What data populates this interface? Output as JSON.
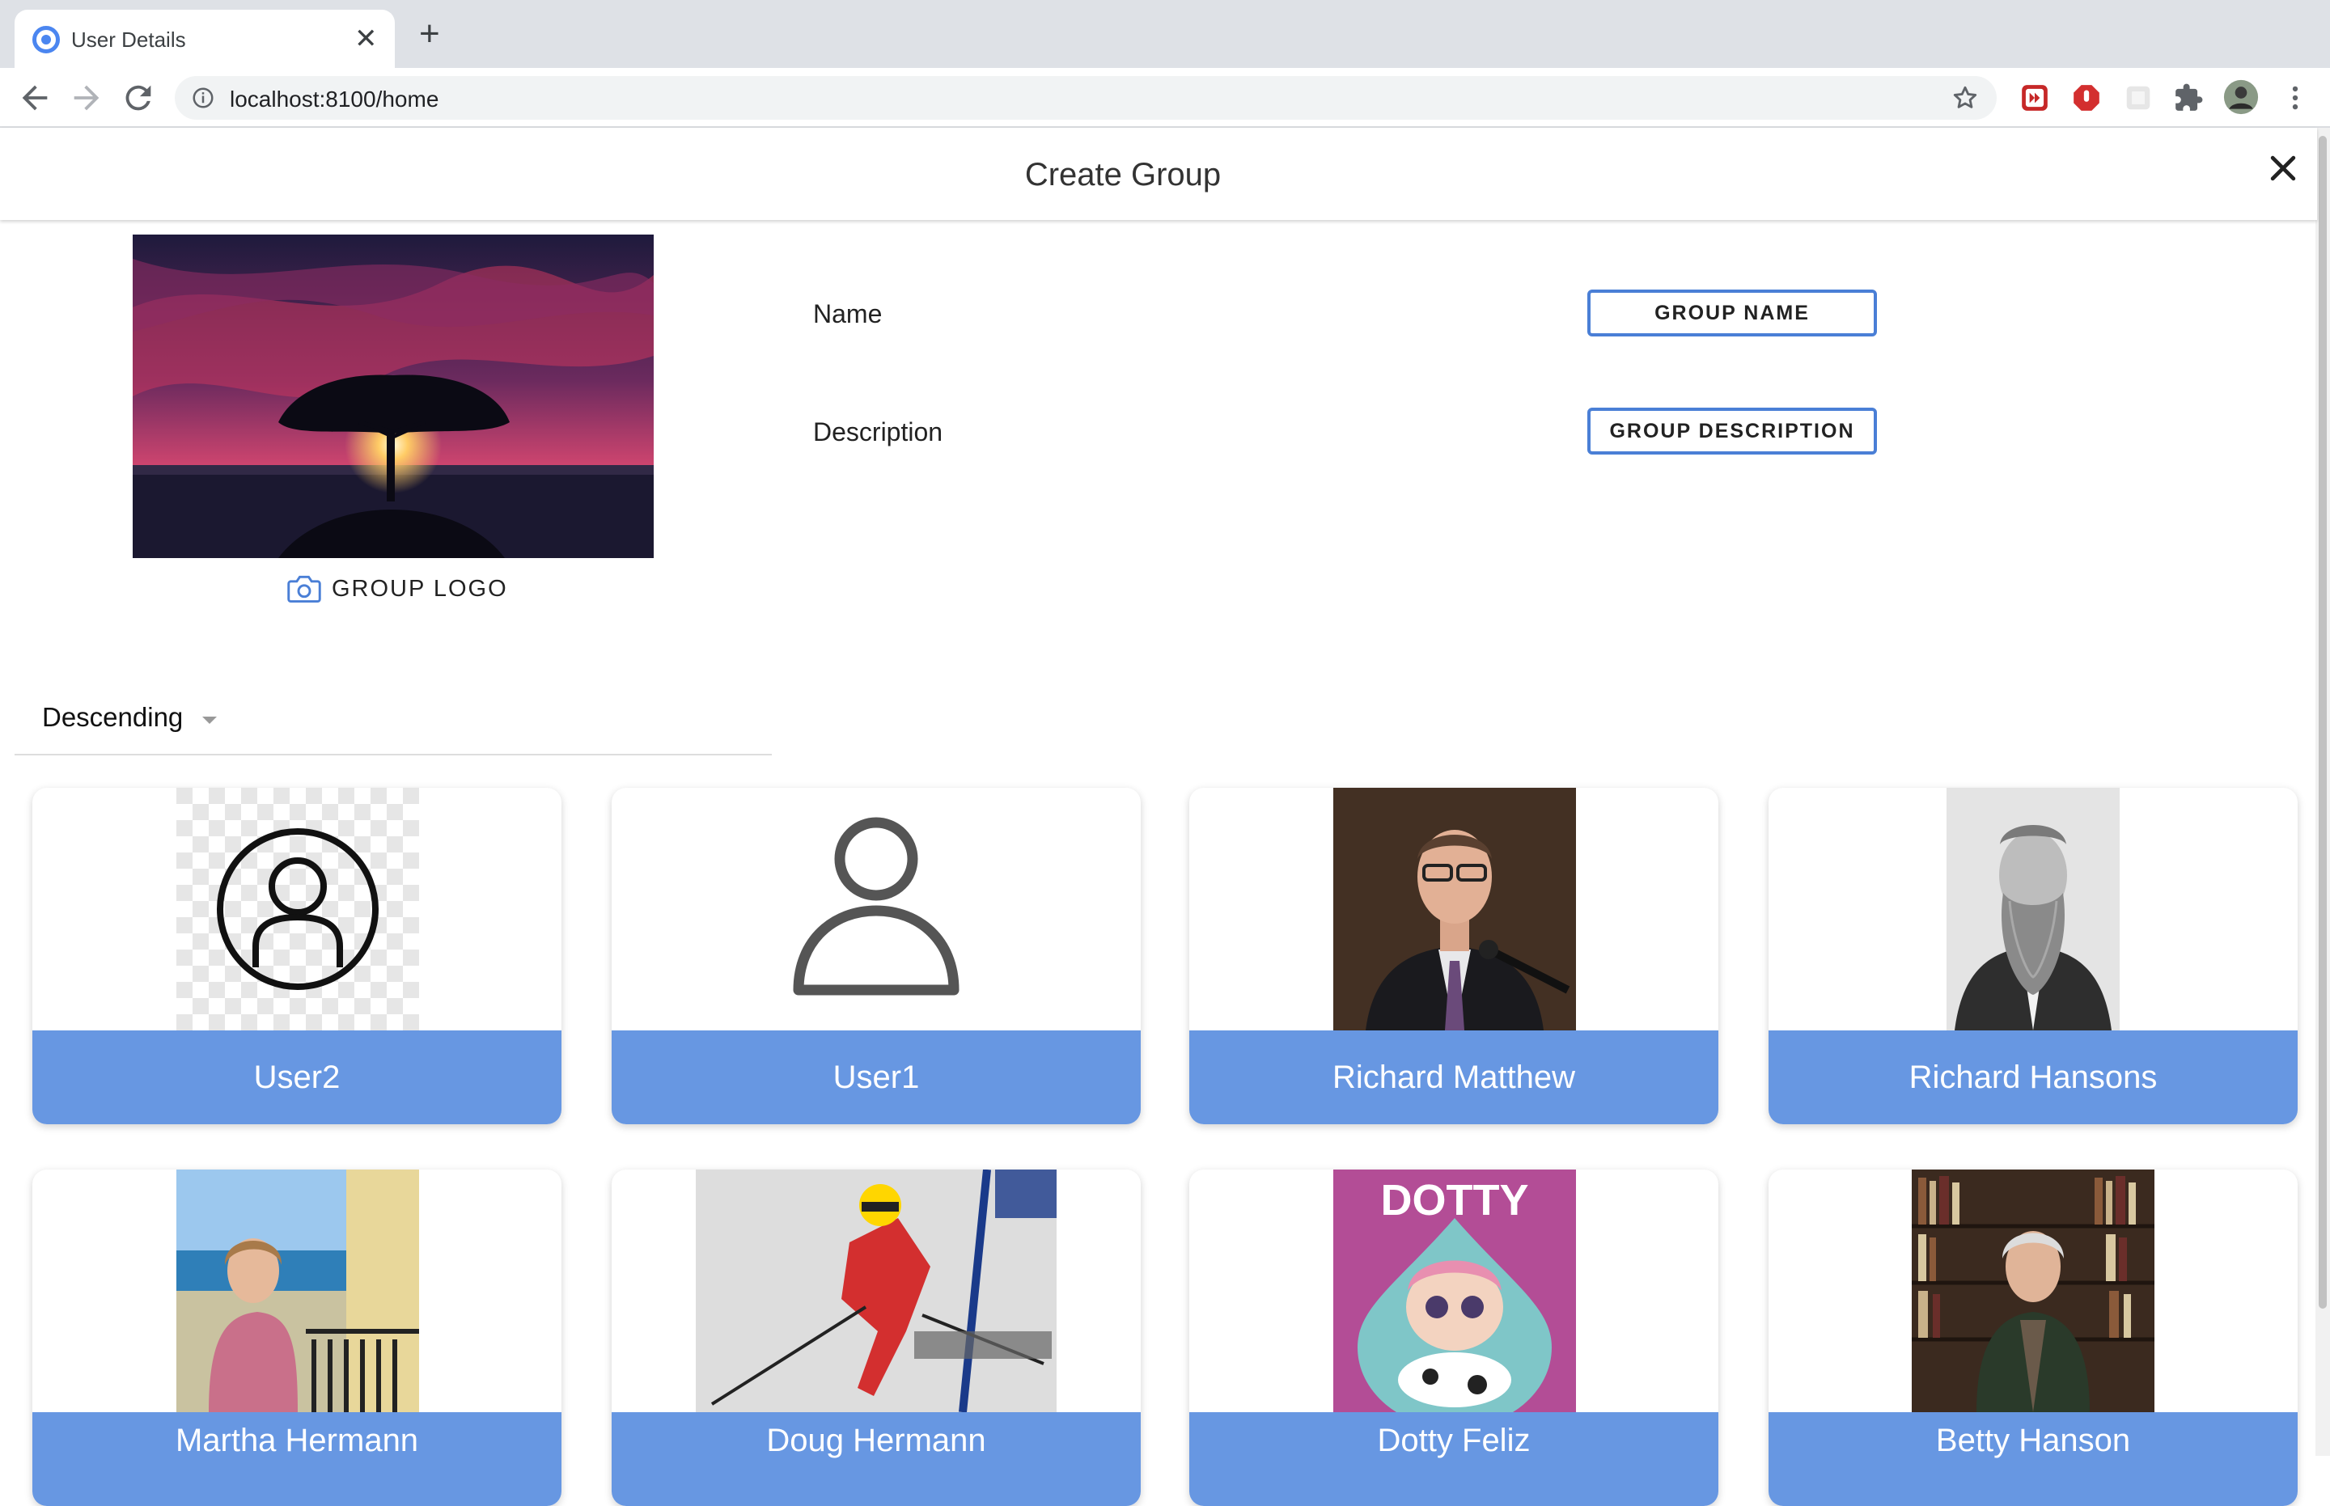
{
  "browser": {
    "tab_title": "User Details",
    "tab_close": "✕",
    "new_tab": "+",
    "url": "localhost:8100/home"
  },
  "page": {
    "title": "Create Group",
    "logo_button_label": "GROUP LOGO",
    "form": {
      "name_label": "Name",
      "name_button": "GROUP NAME",
      "description_label": "Description",
      "description_button": "GROUP DESCRIPTION"
    },
    "sort": {
      "selected": "Descending"
    }
  },
  "users": [
    {
      "name": "User2",
      "photo": "default-avatar-transparent"
    },
    {
      "name": "User1",
      "photo": "default-person-silhouette"
    },
    {
      "name": "Richard Matthew",
      "photo": "man-with-microphone"
    },
    {
      "name": "Richard Hansons",
      "photo": "bearded-man-engraving"
    },
    {
      "name": "Martha Hermann",
      "photo": "woman-on-balcony"
    },
    {
      "name": "Doug Hermann",
      "photo": "skier"
    },
    {
      "name": "Dotty Feliz",
      "photo": "dotty-doll"
    },
    {
      "name": "Betty Hanson",
      "photo": "woman-at-bookshelf"
    }
  ],
  "dotty_banner": "DOTTY",
  "colors": {
    "accent": "#6797e2",
    "button_border": "#4a7fd6"
  }
}
